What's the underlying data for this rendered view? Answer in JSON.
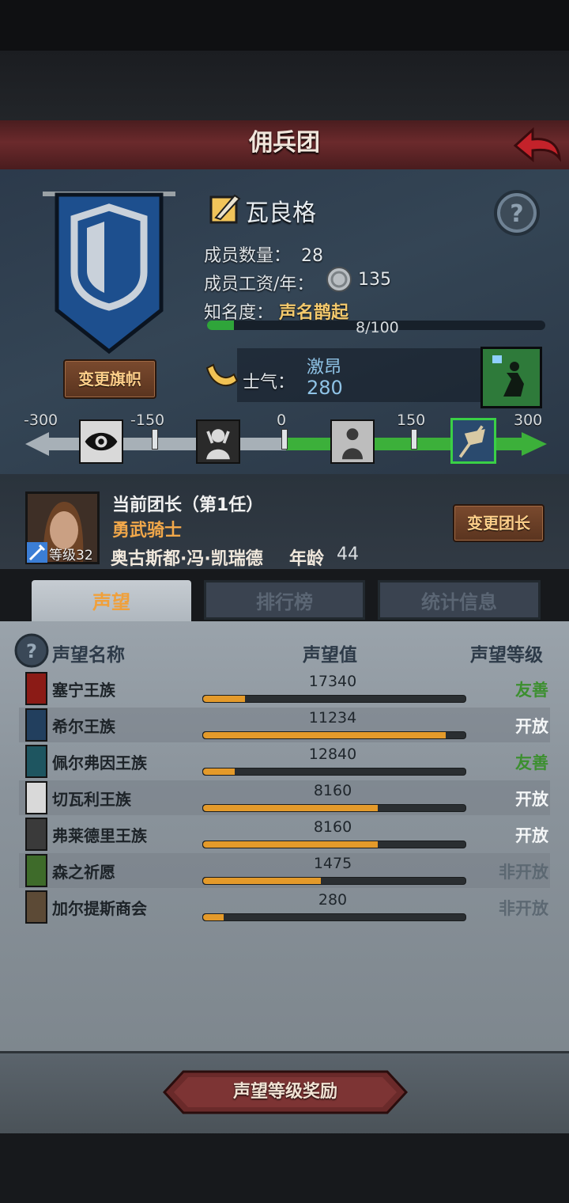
{
  "header": {
    "title": "佣兵团"
  },
  "guild": {
    "name": "瓦良格",
    "change_flag_label": "变更旗帜",
    "members_label": "成员数量：",
    "members_value": "28",
    "salary_label": "成员工资/年：",
    "salary_value": "135",
    "fame_label": "知名度：",
    "fame_value": "声名鹊起",
    "fame_progress_text": "8/100",
    "fame_progress": 0.08,
    "morale_label": "士气：",
    "morale_state": "激昂",
    "morale_value": "280"
  },
  "morale_scale": {
    "ticks": [
      "-300",
      "-150",
      "0",
      "150",
      "300"
    ],
    "current": 280,
    "range": [
      -300,
      300
    ],
    "icons": [
      "eye-icon",
      "despair-icon",
      "calm-icon",
      "banner-icon"
    ]
  },
  "leader": {
    "title": "当前团长（第1任）",
    "class": "勇武骑士",
    "name": "奥古斯都·冯·凯瑞德",
    "age_label": "年龄",
    "age": "44",
    "level_label": "等级32",
    "change_label": "变更团长"
  },
  "tabs": [
    {
      "label": "声望",
      "active": true
    },
    {
      "label": "排行榜",
      "active": false
    },
    {
      "label": "统计信息",
      "active": false
    }
  ],
  "reputation": {
    "columns": {
      "name": "声望名称",
      "value": "声望值",
      "level": "声望等级"
    },
    "rows": [
      {
        "name": "塞宁王族",
        "value": "17340",
        "fill": 0.16,
        "level": "友善",
        "level_color": "#3c8f2f",
        "icon_color": "#8b1b16"
      },
      {
        "name": "希尔王族",
        "value": "11234",
        "fill": 0.93,
        "level": "开放",
        "level_color": "#f4f6f7",
        "icon_color": "#223f5e"
      },
      {
        "name": "佩尔弗因王族",
        "value": "12840",
        "fill": 0.12,
        "level": "友善",
        "level_color": "#3c8f2f",
        "icon_color": "#1e5560"
      },
      {
        "name": "切瓦利王族",
        "value": "8160",
        "fill": 0.67,
        "level": "开放",
        "level_color": "#f4f6f7",
        "icon_color": "#d9d9d9"
      },
      {
        "name": "弗莱德里王族",
        "value": "8160",
        "fill": 0.67,
        "level": "开放",
        "level_color": "#f4f6f7",
        "icon_color": "#3a3a3a"
      },
      {
        "name": "森之祈愿",
        "value": "1475",
        "fill": 0.45,
        "level": "非开放",
        "level_color": "#5c6872",
        "icon_color": "#3e6b2a"
      },
      {
        "name": "加尔提斯商会",
        "value": "280",
        "fill": 0.08,
        "level": "非开放",
        "level_color": "#5c6872",
        "icon_color": "#5c4a36"
      }
    ]
  },
  "footer": {
    "reward_label": "声望等级奖励"
  }
}
